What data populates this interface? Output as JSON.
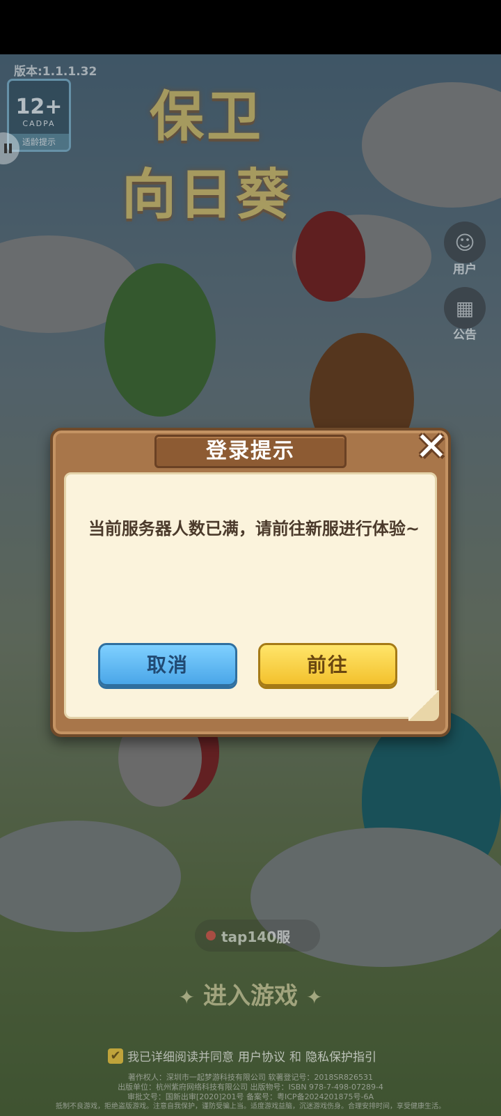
{
  "version": "版本:1.1.1.32",
  "age_badge": {
    "age": "12+",
    "org": "CADPA",
    "tip": "适龄提示"
  },
  "logo": {
    "line1": "保卫",
    "line2": "向日葵"
  },
  "side_buttons": {
    "user": "用户",
    "notice": "公告"
  },
  "server": "tap140服",
  "enter": "进入游戏",
  "agreement": {
    "text": "我已详细阅读并同意",
    "link1": "用户协议",
    "and": "和",
    "link2": "隐私保护指引"
  },
  "footer": [
    "著作权人：深圳市一起梦游科技有限公司  软著登记号：2018SR826531",
    "出版单位：杭州紫府网络科技有限公司  出版物号：ISBN 978-7-498-07289-4",
    "审批文号：国新出审[2020]201号  备案号：粤ICP备2024201875号-6A",
    "抵制不良游戏，拒绝盗版游戏。注意自我保护，谨防受骗上当。适度游戏益脑，沉迷游戏伤身。合理安排时间，享受健康生活。"
  ],
  "dialog": {
    "title": "登录提示",
    "message": "当前服务器人数已满，请前往新服进行体验~",
    "cancel": "取消",
    "confirm": "前往"
  }
}
